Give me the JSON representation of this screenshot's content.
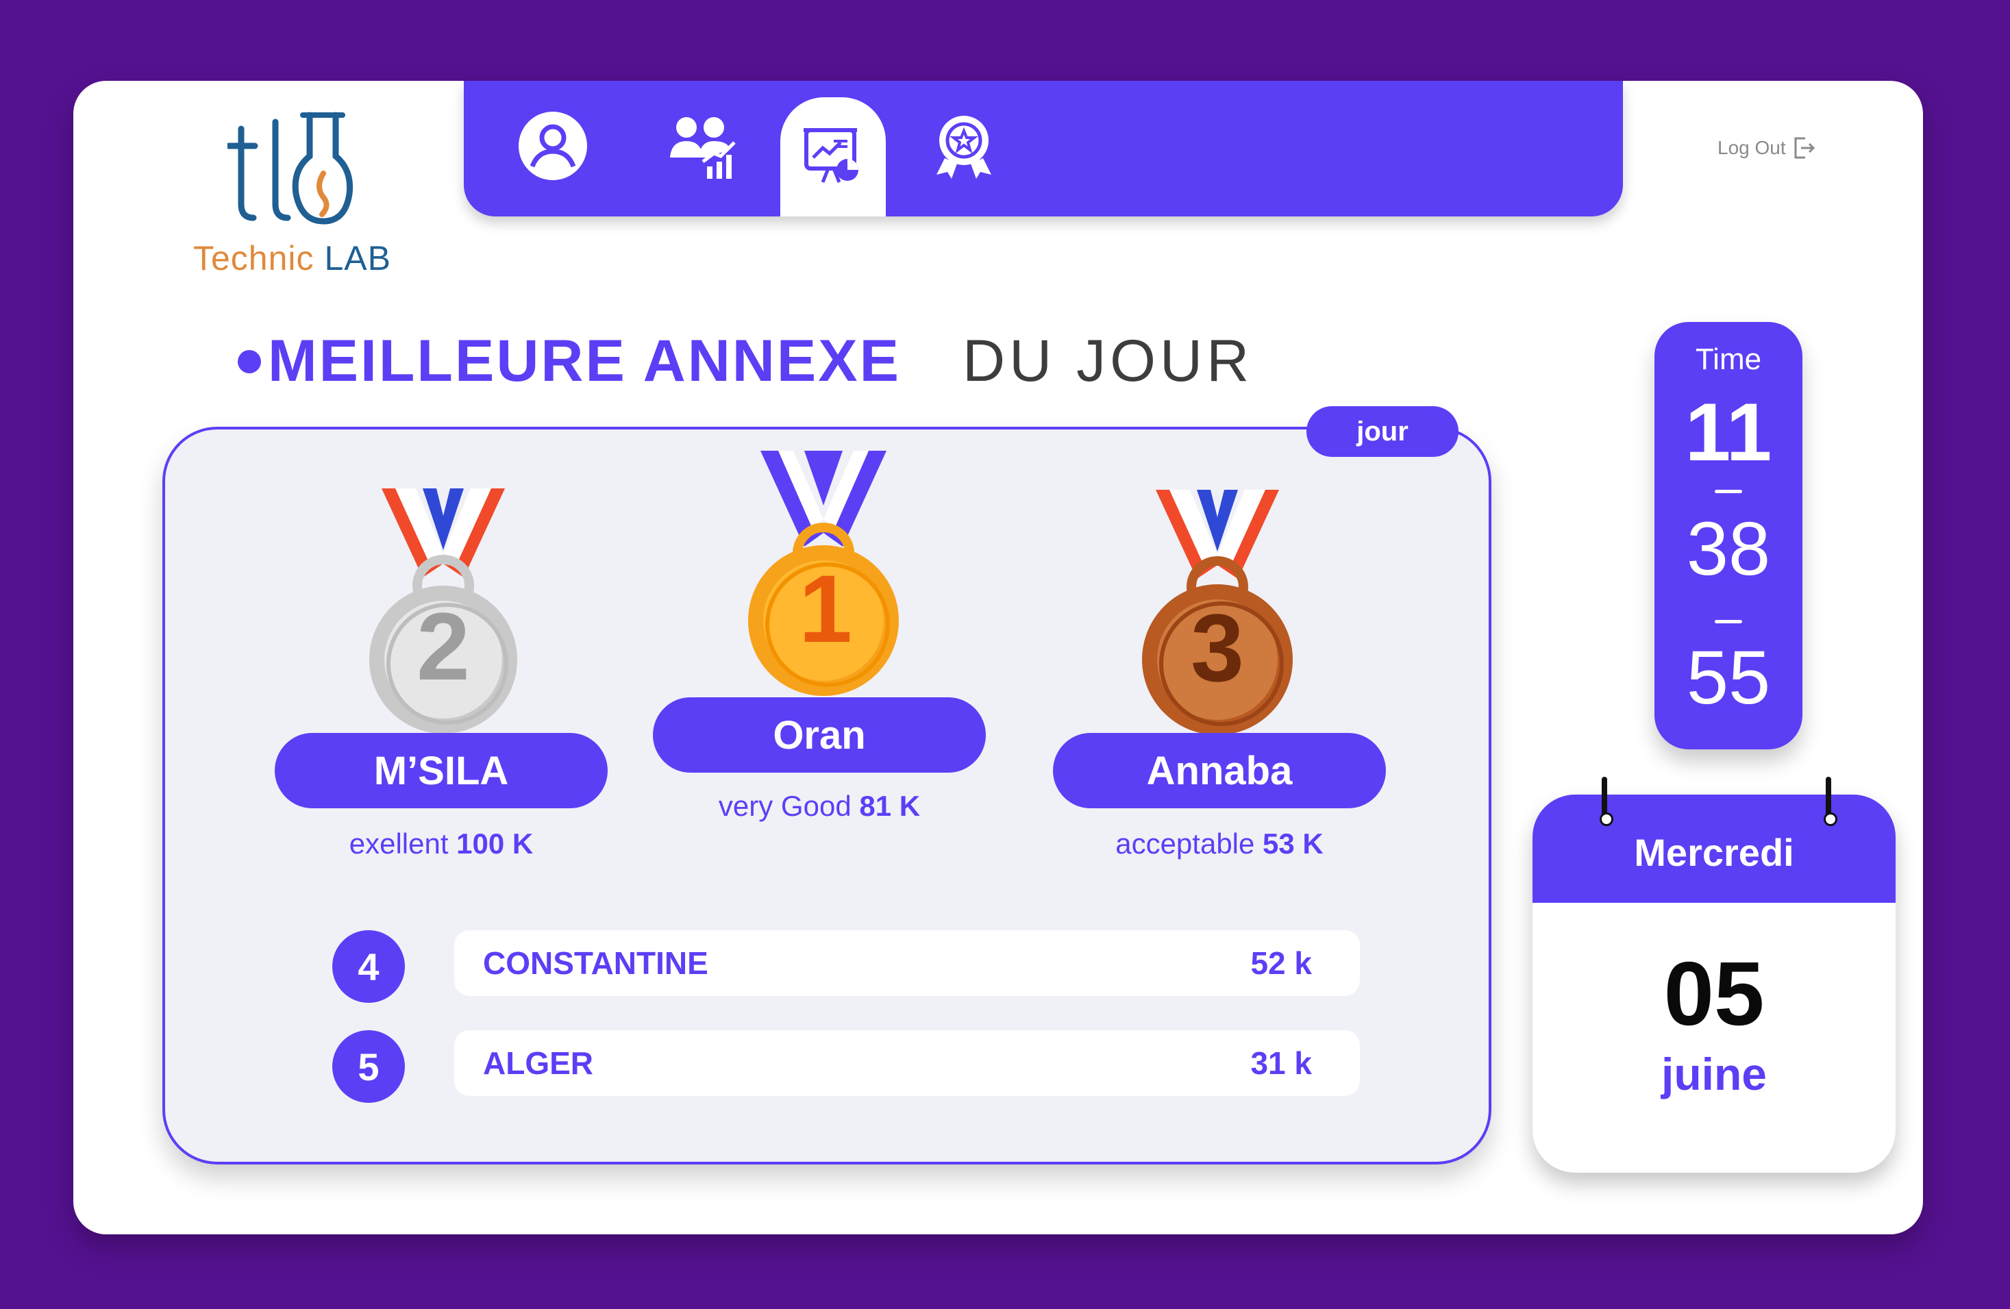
{
  "brand": {
    "logo_mark": "tlb",
    "name_part1": "Technic",
    "name_part2": "LAB"
  },
  "nav": {
    "items": [
      {
        "icon": "user-icon",
        "active": false
      },
      {
        "icon": "team-stats-icon",
        "active": false
      },
      {
        "icon": "dashboard-presentation-icon",
        "active": true
      },
      {
        "icon": "award-badge-icon",
        "active": false
      }
    ],
    "logout_label": "Log Out"
  },
  "heading": {
    "title_bold": "MEILLEURE ANNEXE",
    "title_light": "DU JOUR"
  },
  "ranking": {
    "period_badge": "jour",
    "podium": [
      {
        "rank": "1",
        "name": "Oran",
        "rating": "very Good",
        "value": "81 K",
        "medal": "gold"
      },
      {
        "rank": "2",
        "name": "M’SILA",
        "rating": "exellent",
        "value": "100 K",
        "medal": "silver"
      },
      {
        "rank": "3",
        "name": "Annaba",
        "rating": "acceptable",
        "value": "53 K",
        "medal": "bronze"
      }
    ],
    "others": [
      {
        "rank": "4",
        "name": "CONSTANTINE",
        "value": "52 k"
      },
      {
        "rank": "5",
        "name": "ALGER",
        "value": "31 k"
      }
    ]
  },
  "clock": {
    "label": "Time",
    "hours": "11",
    "minutes": "38",
    "seconds": "55"
  },
  "calendar": {
    "weekday": "Mercredi",
    "day": "05",
    "month": "juine"
  },
  "colors": {
    "background": "#551190",
    "accent": "#5b3ff5",
    "gold": "#f7a21b",
    "silver": "#c9c9c9",
    "bronze": "#b85a22"
  }
}
